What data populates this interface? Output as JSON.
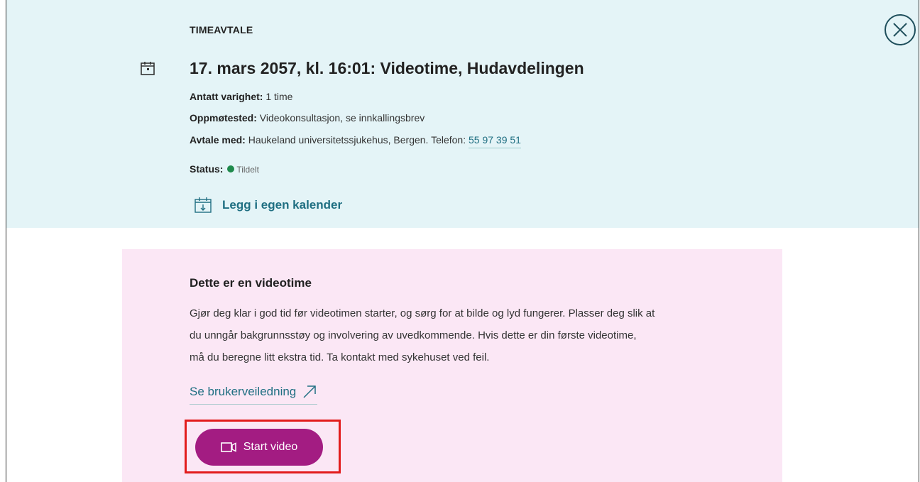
{
  "appointment": {
    "eyebrow": "TIMEAVTALE",
    "title": "17. mars 2057, kl. 16:01: Videotime, Hudavdelingen",
    "duration_label": "Antatt varighet:",
    "duration_value": "1 time",
    "location_label": "Oppmøtested:",
    "location_value": "Videokonsultasjon, se innkallingsbrev",
    "with_label": "Avtale med:",
    "with_value": "Haukeland universitetssjukehus, Bergen. Telefon:",
    "phone": "55 97 39 51",
    "status_label": "Status:",
    "status_value": "Tildelt",
    "add_calendar_label": "Legg i egen kalender"
  },
  "video_card": {
    "heading": "Dette er en videotime",
    "body_line1": "Gjør deg klar i god tid før videotimen starter, og sørg for at bilde og lyd fungerer. Plasser deg slik at",
    "body_line2": "du unngår bakgrunnsstøy og involvering av uvedkommende. Hvis dette er din første videotime,",
    "body_line3": "må du beregne litt ekstra tid. Ta kontakt med sykehuset ved feil.",
    "guide_link": "Se brukerveiledning",
    "start_button": "Start video"
  },
  "icons": {
    "close": "close-icon",
    "calendar": "calendar-icon",
    "calendar_add": "calendar-download-icon",
    "external_link": "external-link-arrow-icon",
    "video": "video-camera-icon"
  },
  "colors": {
    "header_bg": "#e4f4f7",
    "card_bg": "#fbe7f5",
    "link": "#1f6f82",
    "button": "#a31c82",
    "status_green": "#1f8a4c",
    "highlight": "#e21c1c"
  }
}
